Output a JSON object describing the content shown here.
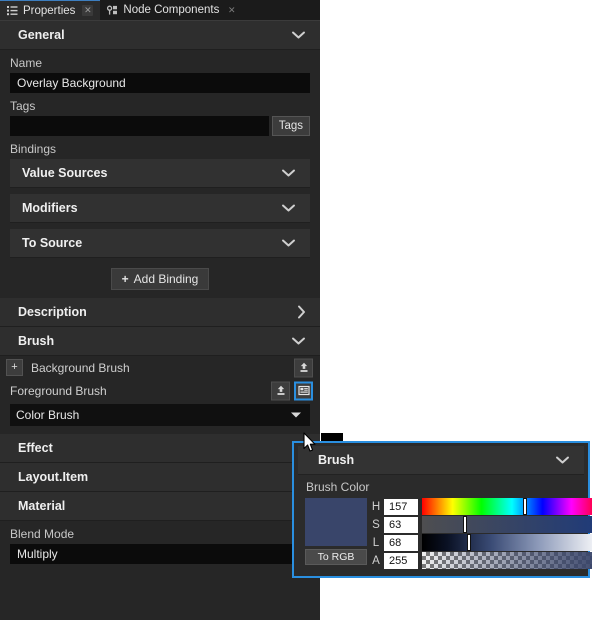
{
  "tabs": [
    {
      "label": "Properties",
      "icon": "list-icon",
      "close": "✕",
      "active": true
    },
    {
      "label": "Node Components",
      "icon": "node-icon",
      "close": "✕",
      "active": false
    }
  ],
  "general": {
    "header": "General",
    "name_label": "Name",
    "name_value": "Overlay Background",
    "tags_label": "Tags",
    "tags_value": "",
    "tags_button": "Tags",
    "bindings_label": "Bindings",
    "binding_items": [
      {
        "label": "Value Sources",
        "state": "expanded"
      },
      {
        "label": "Modifiers",
        "state": "expanded"
      },
      {
        "label": "To Source",
        "state": "expanded"
      }
    ],
    "add_binding": "Add Binding",
    "add_binding_plus": "+"
  },
  "sections": [
    {
      "label": "Description",
      "state": "collapsed"
    },
    {
      "label": "Brush",
      "state": "expanded"
    }
  ],
  "brush": {
    "background_row": {
      "label": "Background Brush",
      "plus": "+",
      "upload_icon": "upload-icon"
    },
    "foreground_row": {
      "label": "Foreground Brush",
      "upload_icon": "upload-icon",
      "panel_icon": "panel-icon"
    },
    "combo_value": "Color Brush"
  },
  "lower_sections": [
    {
      "label": "Effect",
      "state": "expanded"
    },
    {
      "label": "Layout.Item",
      "state": "expanded"
    },
    {
      "label": "Material",
      "state": "expanded"
    }
  ],
  "material": {
    "blend_mode_label": "Blend Mode",
    "blend_mode_value": "Multiply"
  },
  "popup": {
    "header": "Brush",
    "color_label": "Brush Color",
    "to_rgb_button": "To RGB",
    "swatch_color": "#39456a",
    "channels": [
      {
        "name": "H",
        "value": "157",
        "handle_pct": 57
      },
      {
        "name": "S",
        "value": "63",
        "handle_pct": 24
      },
      {
        "name": "L",
        "value": "68",
        "handle_pct": 26
      },
      {
        "name": "A",
        "value": "255",
        "handle_pct": 97
      }
    ]
  },
  "colors": {
    "accent": "#2a8fe0",
    "panel_bg": "#262626",
    "section_bg": "#2e2e2e",
    "field_bg": "#0b0b0b",
    "text": "#e8e8e8"
  }
}
